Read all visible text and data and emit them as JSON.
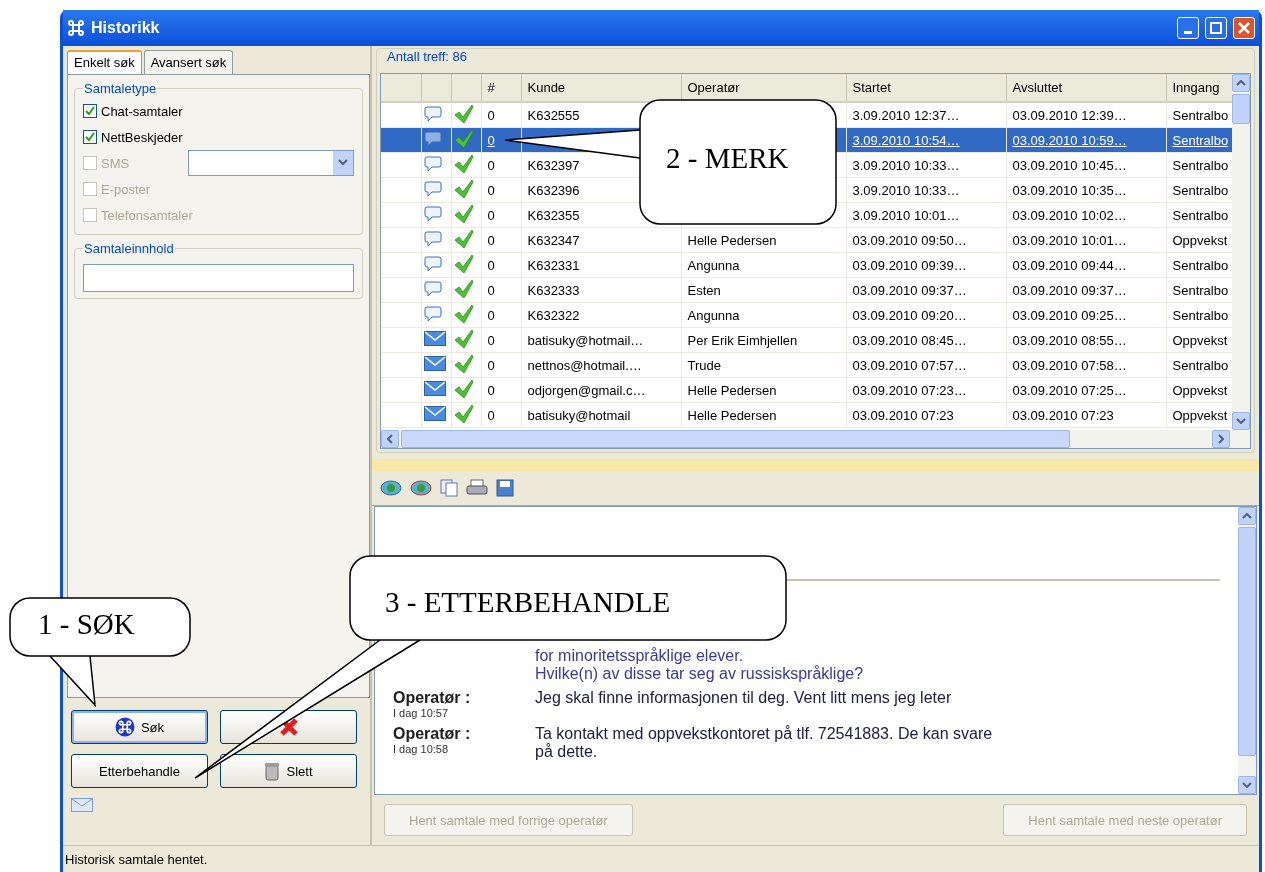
{
  "window": {
    "title": "Historikk"
  },
  "search_tabs": [
    {
      "label": "Enkelt søk",
      "selected": true
    },
    {
      "label": "Avansert søk",
      "selected": false
    }
  ],
  "conversation_type": {
    "legend": "Samtaletype",
    "options": [
      {
        "label": "Chat-samtaler",
        "checked": true,
        "disabled": false
      },
      {
        "label": "NettBeskjeder",
        "checked": true,
        "disabled": false
      },
      {
        "label": "SMS",
        "checked": false,
        "disabled": true,
        "dropdown": true
      },
      {
        "label": "E-poster",
        "checked": false,
        "disabled": true
      },
      {
        "label": "Telefonsamtaler",
        "checked": false,
        "disabled": true
      }
    ]
  },
  "content_search": {
    "legend": "Samtaleinnhold"
  },
  "actions": [
    {
      "label": "Søk",
      "kind": "search",
      "focused": true
    },
    {
      "kind": "close",
      "focused": false
    },
    {
      "label": "Etterbehandle",
      "kind": "plain",
      "focused": false
    },
    {
      "label": "Slett",
      "kind": "delete",
      "focused": false
    }
  ],
  "results": {
    "legend": "Antall treff: 86",
    "columns": [
      "#",
      "Kunde",
      "Operatør",
      "Startet",
      "Avsluttet",
      "Inngang"
    ],
    "rows": [
      {
        "kind": "chat",
        "selected": false,
        "cells": [
          "0",
          "K632555",
          "",
          "3.09.2010 12:37…",
          "03.09.2010 12:39…",
          "Sentralbo"
        ]
      },
      {
        "kind": "chat",
        "selected": true,
        "cells": [
          "0",
          "",
          "",
          "3.09.2010 10:54…",
          "03.09.2010 10:59…",
          "Sentralbo"
        ]
      },
      {
        "kind": "chat",
        "selected": false,
        "cells": [
          "0",
          "K632397",
          "",
          "3.09.2010 10:33…",
          "03.09.2010 10:45…",
          "Sentralbo"
        ]
      },
      {
        "kind": "chat",
        "selected": false,
        "cells": [
          "0",
          "K632396",
          "",
          "3.09.2010 10:33…",
          "03.09.2010 10:35…",
          "Sentralbo"
        ]
      },
      {
        "kind": "chat",
        "selected": false,
        "cells": [
          "0",
          "K632355",
          "",
          "3.09.2010 10:01…",
          "03.09.2010 10:02…",
          "Sentralbo"
        ]
      },
      {
        "kind": "chat",
        "selected": false,
        "cells": [
          "0",
          "K632347",
          "Helle  Pedersen",
          "03.09.2010 09:50…",
          "03.09.2010 10:01…",
          "Oppvekst"
        ]
      },
      {
        "kind": "chat",
        "selected": false,
        "cells": [
          "0",
          "K632331",
          "Angunna",
          "03.09.2010 09:39…",
          "03.09.2010 09:44…",
          "Sentralbo"
        ]
      },
      {
        "kind": "chat",
        "selected": false,
        "cells": [
          "0",
          "K632333",
          "Esten",
          "03.09.2010 09:37…",
          "03.09.2010 09:37…",
          "Sentralbo"
        ]
      },
      {
        "kind": "chat",
        "selected": false,
        "cells": [
          "0",
          "K632322",
          "Angunna",
          "03.09.2010 09:20…",
          "03.09.2010 09:25…",
          "Sentralbo"
        ]
      },
      {
        "kind": "mail",
        "selected": false,
        "cells": [
          "0",
          "batisuky@hotmail…",
          "Per Erik  Eimhjellen",
          "03.09.2010 08:45…",
          "03.09.2010 08:55…",
          "Oppvekst"
        ]
      },
      {
        "kind": "mail",
        "selected": false,
        "cells": [
          "0",
          "nettnos@hotmail.…",
          "Trude",
          "03.09.2010 07:57…",
          "03.09.2010 07:58…",
          "Sentralbo"
        ]
      },
      {
        "kind": "mail",
        "selected": false,
        "cells": [
          "0",
          "odjorgen@gmail.c…",
          "Helle  Pedersen",
          "03.09.2010 07:23…",
          "03.09.2010 07:25…",
          "Oppvekst"
        ]
      },
      {
        "kind": "mail",
        "selected": false,
        "cells": [
          "0",
          "batisuky@hotmail",
          "Helle  Pedersen",
          "03.09.2010 07:23",
          "03.09.2010 07:23",
          "Oppvekst"
        ]
      }
    ]
  },
  "transcript": {
    "messages": [
      {
        "kind": "customer",
        "lines": [
          "for minoritetsspråklige elever.",
          "Hvilke(n) av disse tar seg av russiskspråklige?"
        ]
      },
      {
        "kind": "operator",
        "sender": "Operatør :",
        "time": "I dag 10:57",
        "lines": [
          "Jeg skal finne informasjonen til deg. Vent litt mens jeg leter"
        ]
      },
      {
        "kind": "operator",
        "sender": "Operatør :",
        "time": "I dag 10:58",
        "lines": [
          "Ta kontakt med oppvekstkontoret på tlf. 72541883. De kan svare",
          "på dette."
        ]
      }
    ]
  },
  "navigation": [
    {
      "label": "Hent samtale med forrige operatør",
      "disabled": true
    },
    {
      "label": "Hent samtale med neste operatør",
      "disabled": true
    }
  ],
  "status_bar": "Historisk samtale hentet.",
  "callouts": [
    {
      "text": "1 - SØK"
    },
    {
      "text": "2 - MERK"
    },
    {
      "text": "3 - ETTERBEHANDLE"
    }
  ]
}
